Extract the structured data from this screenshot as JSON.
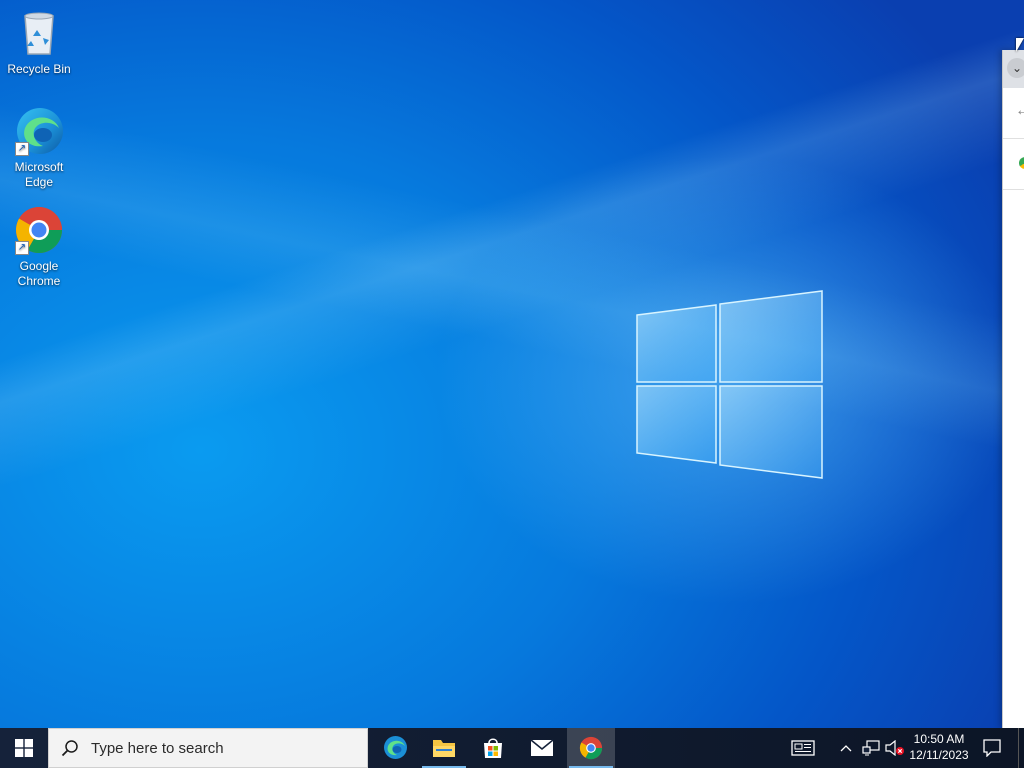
{
  "desktop": {
    "icons": [
      {
        "label": "Recycle Bin",
        "icon": "recycle-bin-icon"
      },
      {
        "label": "Microsoft\nEdge",
        "icon": "edge-icon"
      },
      {
        "label": "Google\nChrome",
        "icon": "chrome-icon"
      }
    ]
  },
  "taskbar": {
    "search": {
      "placeholder": "Type here to search"
    },
    "apps": [
      {
        "name": "Microsoft Edge",
        "icon": "edge-icon"
      },
      {
        "name": "File Explorer",
        "icon": "folder-icon"
      },
      {
        "name": "Microsoft Store",
        "icon": "store-icon"
      },
      {
        "name": "Mail",
        "icon": "mail-icon"
      },
      {
        "name": "Google Chrome",
        "icon": "chrome-icon"
      }
    ],
    "tray": {
      "time": "10:50 AM",
      "date": "12/11/2023"
    }
  },
  "colors": {
    "taskbar": "#15223a",
    "desktop_accent": "#0679dd",
    "running_indicator": "#76b9ed"
  }
}
